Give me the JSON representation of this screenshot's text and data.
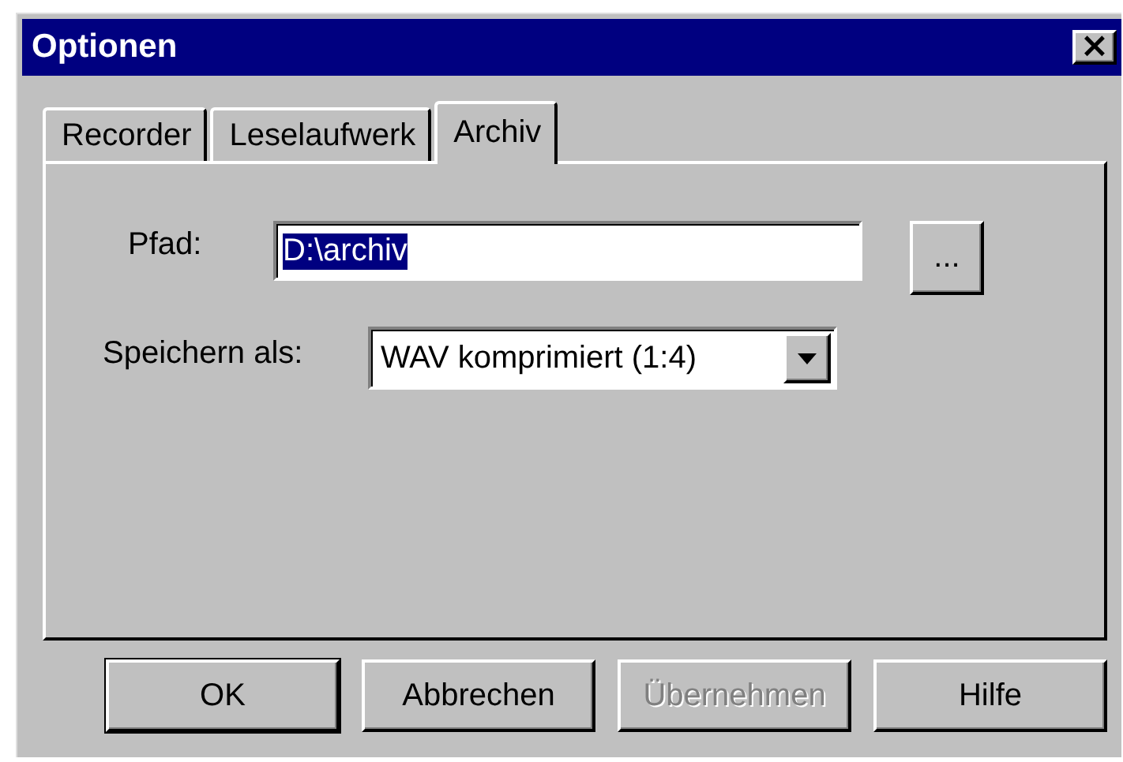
{
  "window": {
    "title": "Optionen",
    "close": "×"
  },
  "tabs": [
    {
      "label": "Recorder",
      "selected": false
    },
    {
      "label": "Leselaufwerk",
      "selected": false
    },
    {
      "label": "Archiv",
      "selected": true
    }
  ],
  "path": {
    "label": "Pfad:",
    "value": "D:\\archiv",
    "browse": "..."
  },
  "save_as": {
    "label": "Speichern als:",
    "value": "WAV komprimiert (1:4)"
  },
  "buttons": [
    {
      "label": "OK",
      "disabled": false,
      "default": true
    },
    {
      "label": "Abbrechen",
      "disabled": false,
      "default": false
    },
    {
      "label": "Übernehmen",
      "disabled": true,
      "default": false
    },
    {
      "label": "Hilfe",
      "disabled": false,
      "default": false
    }
  ]
}
